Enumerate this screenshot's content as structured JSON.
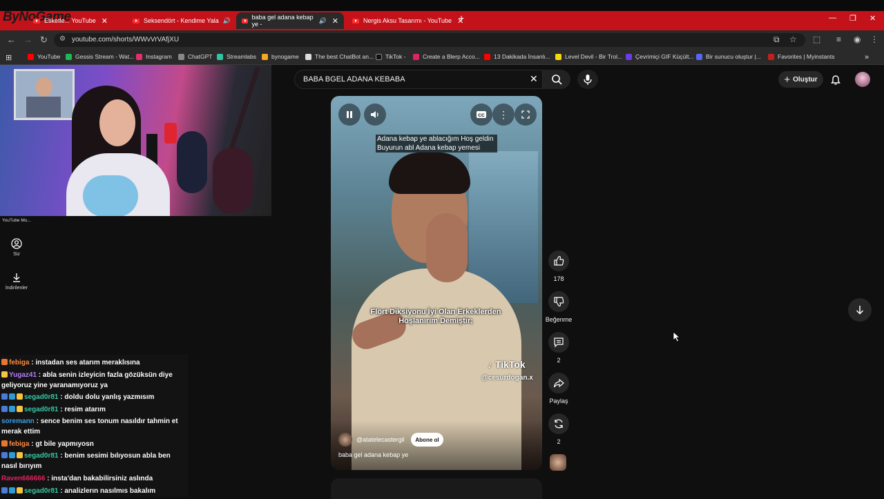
{
  "brand": {
    "logo_text": "ByNoGame"
  },
  "browser": {
    "tabs": [
      {
        "title": "Etiketle... YouTube",
        "active": false
      },
      {
        "title": "Seksendört - Kendime Yala",
        "active": false
      },
      {
        "title": "baba gel adana kebap ye -",
        "active": true
      },
      {
        "title": "Nergis Aksu Tasarımı - YouTube",
        "active": false
      }
    ],
    "url": "youtube.com/shorts/WWvVrVAfjXU",
    "bookmarks": [
      {
        "label": "YouTube",
        "color": "#ff0000"
      },
      {
        "label": "Gessis Stream - Wat...",
        "color": "#1db954"
      },
      {
        "label": "Instagram",
        "color": "#e1306c"
      },
      {
        "label": "ChatGPT",
        "color": "#888888"
      },
      {
        "label": "Streamlabs",
        "color": "#31c3a2"
      },
      {
        "label": "bynogame",
        "color": "#f5a623"
      },
      {
        "label": "The best ChatBot an...",
        "color": "#dddddd"
      },
      {
        "label": "TikTok -",
        "color": "#111111"
      },
      {
        "label": "Create a Blerp Acco...",
        "color": "#e0245e"
      },
      {
        "label": "13 Dakikada İnsanlı...",
        "color": "#ff0000"
      },
      {
        "label": "Level Devil - Bir Trol...",
        "color": "#f5d90a"
      },
      {
        "label": "Çevrimiçi GIF Küçült...",
        "color": "#6a3de8"
      },
      {
        "label": "Bir sunucu oluştur |...",
        "color": "#5865f2"
      },
      {
        "label": "Favorites | Myinstants",
        "color": "#c41e1e"
      }
    ]
  },
  "youtube": {
    "search_query": "BABA BGEL ADANA KEBABA",
    "create_label": "Oluştur",
    "sidebar": [
      {
        "label": "Siz",
        "icon": "account-icon"
      },
      {
        "label": "İndirilenler",
        "icon": "download-icon"
      }
    ],
    "overlay_label": "YouTube Mu...",
    "short": {
      "caption_lines": [
        "Adana kebap ye ablacığım Hoş geldin",
        "Buyurun abl Adana kebap yemesi"
      ],
      "overlay_text": [
        "Flört Diksiyonu İyi Olan Erkeklerden",
        "Hoşlanırım Demiştir;"
      ],
      "watermark_logo": "TikTok",
      "watermark_handle": "@cesurdogan.x",
      "channel": "@atatelecastergil",
      "subscribe_label": "Abone ol",
      "title": "baba gel adana kebap ye"
    },
    "actions": {
      "likes": "178",
      "dislike_label": "Beğenme",
      "comments": "2",
      "share_label": "Paylaş",
      "remix": "2"
    }
  },
  "chat": [
    {
      "user": "febiga",
      "user_color": "#ff8a3d",
      "text": "instadan ses atarım meraklısına",
      "badges": [
        "#e8772e"
      ]
    },
    {
      "user": "Yugaz41",
      "user_color": "#b57bff",
      "text": "abla senin izleyicin fazla gözüksün diye geliyoruz yine yaranamıyoruz ya",
      "badges": [
        "#f5c542"
      ]
    },
    {
      "user": "segad0r81",
      "user_color": "#35c9a5",
      "text": "doldu dolu yanlış yazmısım",
      "badges": [
        "#4a7bd8",
        "#2f9bd6",
        "#f5c542"
      ]
    },
    {
      "user": "segad0r81",
      "user_color": "#35c9a5",
      "text": "resim atarım",
      "badges": [
        "#4a7bd8",
        "#2f9bd6",
        "#f5c542"
      ]
    },
    {
      "user": "soremann",
      "user_color": "#3aa0e6",
      "text": "sence benim ses tonum nasıldır tahmin et merak ettim",
      "badges": []
    },
    {
      "user": "febiga",
      "user_color": "#ff8a3d",
      "text": "gt bile yapmıyosn",
      "badges": [
        "#e8772e"
      ]
    },
    {
      "user": "segad0r81",
      "user_color": "#35c9a5",
      "text": "benim sesimi bılıyosun abla ben nasıl bırıyım",
      "badges": [
        "#4a7bd8",
        "#2f9bd6",
        "#f5c542"
      ]
    },
    {
      "user": "Raven666666",
      "user_color": "#e0245e",
      "text": "insta'dan bakabilirsiniz aslında",
      "badges": []
    },
    {
      "user": "segad0r81",
      "user_color": "#35c9a5",
      "text": "analizlerın nasılmıs bakalım",
      "badges": [
        "#4a7bd8",
        "#2f9bd6",
        "#f5c542"
      ]
    }
  ]
}
